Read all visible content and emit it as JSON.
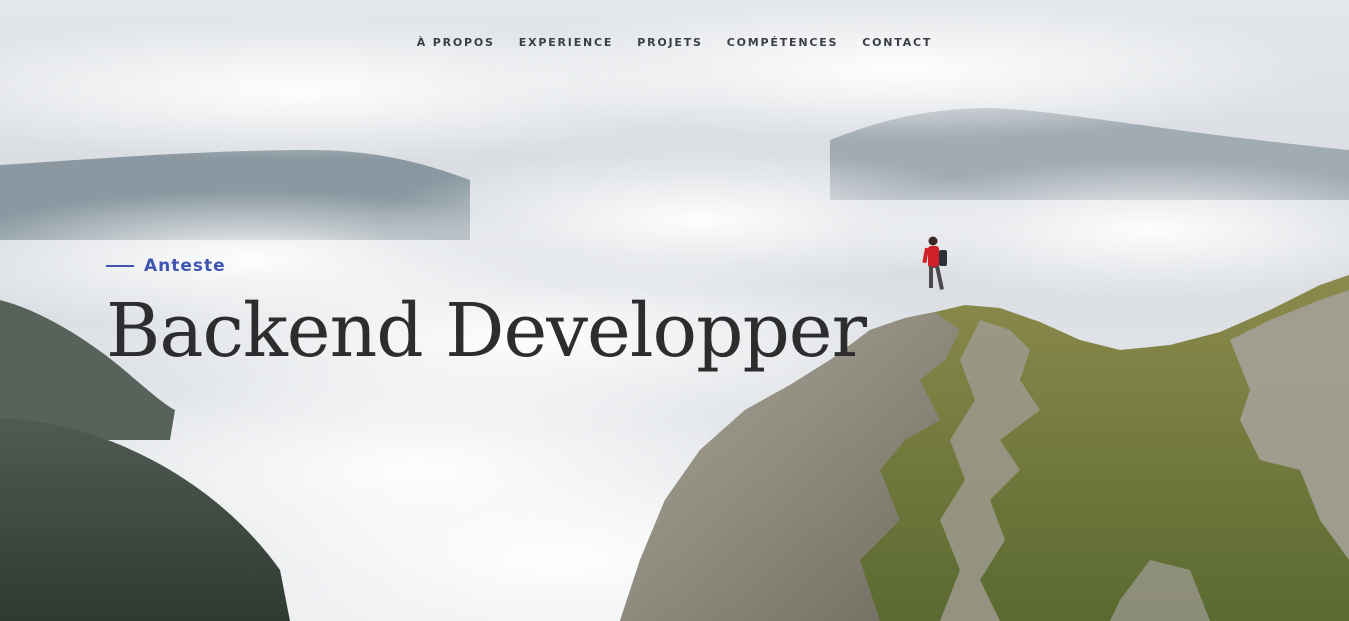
{
  "nav": {
    "items": [
      {
        "label": "À PROPOS"
      },
      {
        "label": "EXPERIENCE"
      },
      {
        "label": "PROJETS"
      },
      {
        "label": "COMPÉTENCES"
      },
      {
        "label": "CONTACT"
      }
    ]
  },
  "hero": {
    "subtitle": "Anteste",
    "title": "Backend Developper",
    "accent_color": "#3f55b0",
    "background_image": "mountain-above-clouds-hiker-photo"
  }
}
